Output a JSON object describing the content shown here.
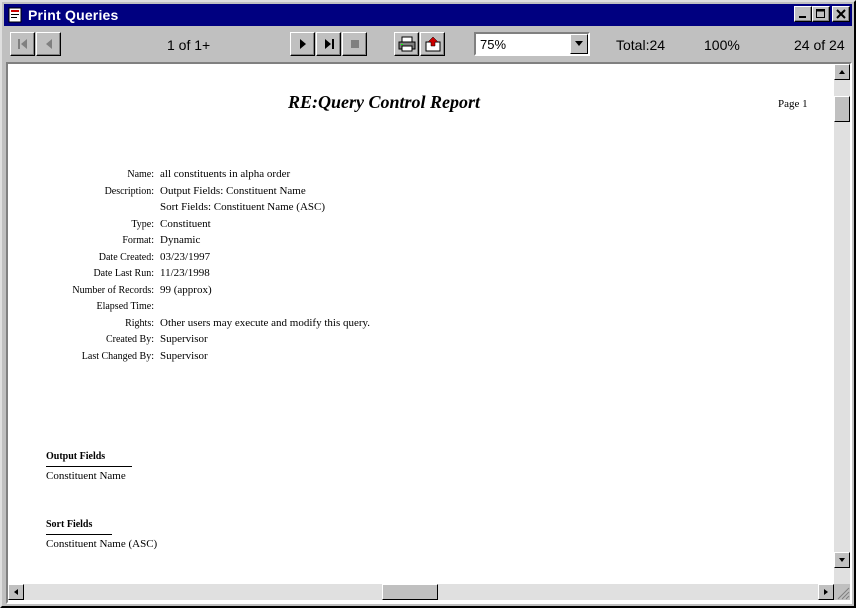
{
  "window": {
    "title": "Print Queries"
  },
  "toolbar": {
    "page_indicator": "1 of 1+",
    "zoom_value": "75%",
    "total": "Total:24",
    "percent": "100%",
    "record_count": "24 of 24"
  },
  "report": {
    "title": "RE:Query Control Report",
    "page_label": "Page 1",
    "fields": [
      {
        "label": "Name:",
        "value": "all constituents in alpha order"
      },
      {
        "label": "Description:",
        "value": "Output Fields: Constituent Name"
      },
      {
        "label": "",
        "value": "Sort Fields: Constituent Name (ASC)"
      },
      {
        "label": "Type:",
        "value": "Constituent"
      },
      {
        "label": "Format:",
        "value": "Dynamic"
      },
      {
        "label": "Date Created:",
        "value": "03/23/1997"
      },
      {
        "label": "Date Last Run:",
        "value": "11/23/1998"
      },
      {
        "label": "Number of Records:",
        "value": "99 (approx)"
      },
      {
        "label": "Elapsed Time:",
        "value": ""
      },
      {
        "label": "Rights:",
        "value": "Other users may execute and modify this query."
      },
      {
        "label": "Created By:",
        "value": "Supervisor"
      },
      {
        "label": "Last Changed By:",
        "value": "Supervisor"
      }
    ],
    "output_fields_label": "Output Fields",
    "output_fields_value": "Constituent Name",
    "sort_fields_label": "Sort Fields",
    "sort_fields_value": "Constituent Name (ASC)"
  },
  "icons": {
    "app": "print-queries-icon",
    "minimize": "minimize-icon",
    "maximize": "maximize-icon",
    "close": "close-icon"
  }
}
